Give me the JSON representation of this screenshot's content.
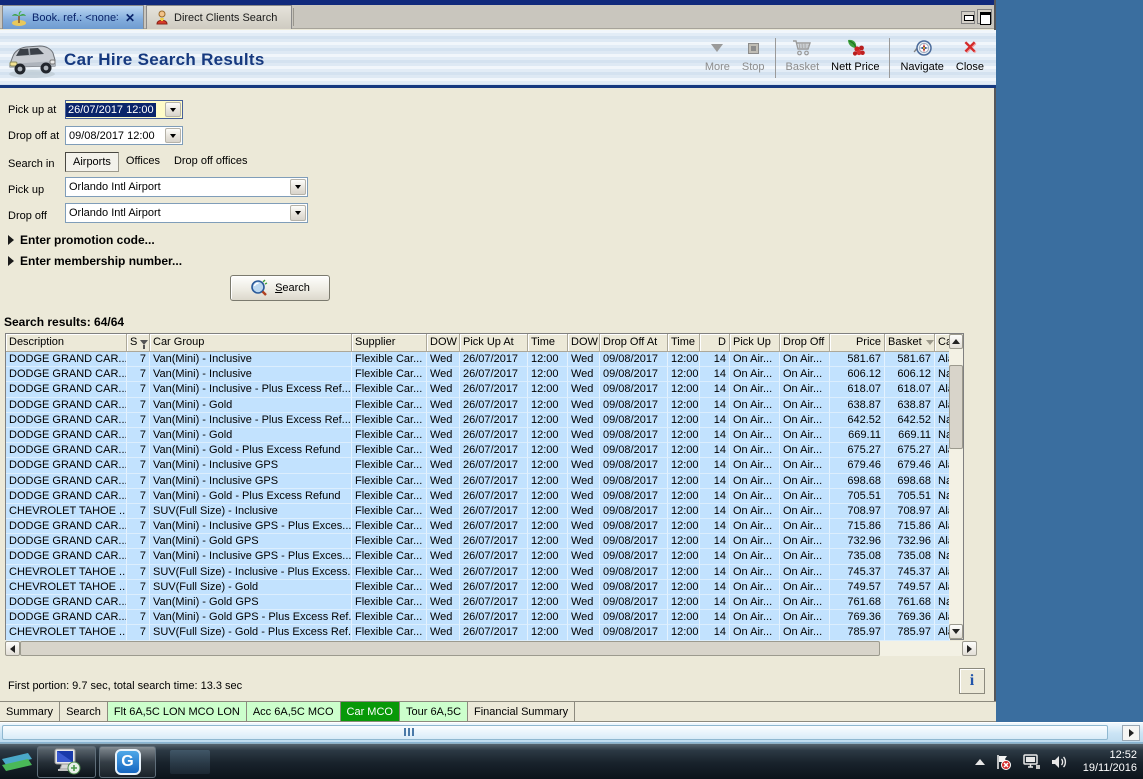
{
  "window": {
    "tabs": [
      {
        "label": "Book. ref.: <none>",
        "close": "✕"
      },
      {
        "label": "Direct Clients Search"
      }
    ],
    "title": "Car Hire Search Results",
    "toolbar": [
      {
        "label": "More"
      },
      {
        "label": "Stop"
      },
      {
        "label": "Basket"
      },
      {
        "label": "Nett Price"
      },
      {
        "label": "Navigate"
      },
      {
        "label": "Close"
      }
    ]
  },
  "form": {
    "pickup_at_label": "Pick up at",
    "pickup_at_value": "26/07/2017 12:00",
    "dropoff_at_label": "Drop off at",
    "dropoff_at_value": "09/08/2017 12:00",
    "search_in_label": "Search in",
    "search_in_options": [
      "Airports",
      "Offices",
      "Drop off offices"
    ],
    "search_in_selected": "Airports",
    "pickup_label": "Pick up",
    "pickup_value": "Orlando Intl Airport",
    "dropoff_label": "Drop off",
    "dropoff_value": "Orlando Intl Airport",
    "promo_expander": "Enter promotion code...",
    "membership_expander": "Enter membership number...",
    "search_button_pre": "S",
    "search_button_rest": "earch"
  },
  "results": {
    "summary": "Search results: 64/64",
    "status": "First portion: 9.7 sec, total search time: 13.3 sec",
    "info_button": "i",
    "columns": [
      "Description",
      "S",
      "Car Group",
      "Supplier",
      "DOW",
      "Pick Up At",
      "Time",
      "DOW",
      "Drop Off At",
      "Time",
      "D",
      "Pick Up",
      "Drop Off",
      "Price",
      "Basket",
      "Ca"
    ],
    "rows": [
      [
        "DODGE GRAND CAR...",
        "7",
        "Van(Mini) - Inclusive",
        "Flexible Car...",
        "Wed",
        "26/07/2017",
        "12:00",
        "Wed",
        "09/08/2017",
        "12:00",
        "14",
        "On Air...",
        "On Air...",
        "581.67",
        "581.67",
        "Ala"
      ],
      [
        "DODGE GRAND CAR...",
        "7",
        "Van(Mini) - Inclusive",
        "Flexible Car...",
        "Wed",
        "26/07/2017",
        "12:00",
        "Wed",
        "09/08/2017",
        "12:00",
        "14",
        "On Air...",
        "On Air...",
        "606.12",
        "606.12",
        "Na"
      ],
      [
        "DODGE GRAND CAR...",
        "7",
        "Van(Mini) - Inclusive - Plus Excess Ref...",
        "Flexible Car...",
        "Wed",
        "26/07/2017",
        "12:00",
        "Wed",
        "09/08/2017",
        "12:00",
        "14",
        "On Air...",
        "On Air...",
        "618.07",
        "618.07",
        "Ala"
      ],
      [
        "DODGE GRAND CAR...",
        "7",
        "Van(Mini) - Gold",
        "Flexible Car...",
        "Wed",
        "26/07/2017",
        "12:00",
        "Wed",
        "09/08/2017",
        "12:00",
        "14",
        "On Air...",
        "On Air...",
        "638.87",
        "638.87",
        "Ala"
      ],
      [
        "DODGE GRAND CAR...",
        "7",
        "Van(Mini) - Inclusive - Plus Excess Ref...",
        "Flexible Car...",
        "Wed",
        "26/07/2017",
        "12:00",
        "Wed",
        "09/08/2017",
        "12:00",
        "14",
        "On Air...",
        "On Air...",
        "642.52",
        "642.52",
        "Na"
      ],
      [
        "DODGE GRAND CAR...",
        "7",
        "Van(Mini) - Gold",
        "Flexible Car...",
        "Wed",
        "26/07/2017",
        "12:00",
        "Wed",
        "09/08/2017",
        "12:00",
        "14",
        "On Air...",
        "On Air...",
        "669.11",
        "669.11",
        "Na"
      ],
      [
        "DODGE GRAND CAR...",
        "7",
        "Van(Mini) - Gold - Plus Excess Refund",
        "Flexible Car...",
        "Wed",
        "26/07/2017",
        "12:00",
        "Wed",
        "09/08/2017",
        "12:00",
        "14",
        "On Air...",
        "On Air...",
        "675.27",
        "675.27",
        "Ala"
      ],
      [
        "DODGE GRAND CAR...",
        "7",
        "Van(Mini) - Inclusive GPS",
        "Flexible Car...",
        "Wed",
        "26/07/2017",
        "12:00",
        "Wed",
        "09/08/2017",
        "12:00",
        "14",
        "On Air...",
        "On Air...",
        "679.46",
        "679.46",
        "Ala"
      ],
      [
        "DODGE GRAND CAR...",
        "7",
        "Van(Mini) - Inclusive GPS",
        "Flexible Car...",
        "Wed",
        "26/07/2017",
        "12:00",
        "Wed",
        "09/08/2017",
        "12:00",
        "14",
        "On Air...",
        "On Air...",
        "698.68",
        "698.68",
        "Na"
      ],
      [
        "DODGE GRAND CAR...",
        "7",
        "Van(Mini) - Gold - Plus Excess Refund",
        "Flexible Car...",
        "Wed",
        "26/07/2017",
        "12:00",
        "Wed",
        "09/08/2017",
        "12:00",
        "14",
        "On Air...",
        "On Air...",
        "705.51",
        "705.51",
        "Na"
      ],
      [
        "CHEVROLET TAHOE ...",
        "7",
        "SUV(Full Size) - Inclusive",
        "Flexible Car...",
        "Wed",
        "26/07/2017",
        "12:00",
        "Wed",
        "09/08/2017",
        "12:00",
        "14",
        "On Air...",
        "On Air...",
        "708.97",
        "708.97",
        "Ala"
      ],
      [
        "DODGE GRAND CAR...",
        "7",
        "Van(Mini) - Inclusive GPS - Plus Exces...",
        "Flexible Car...",
        "Wed",
        "26/07/2017",
        "12:00",
        "Wed",
        "09/08/2017",
        "12:00",
        "14",
        "On Air...",
        "On Air...",
        "715.86",
        "715.86",
        "Ala"
      ],
      [
        "DODGE GRAND CAR...",
        "7",
        "Van(Mini) - Gold GPS",
        "Flexible Car...",
        "Wed",
        "26/07/2017",
        "12:00",
        "Wed",
        "09/08/2017",
        "12:00",
        "14",
        "On Air...",
        "On Air...",
        "732.96",
        "732.96",
        "Ala"
      ],
      [
        "DODGE GRAND CAR...",
        "7",
        "Van(Mini) - Inclusive GPS - Plus Exces...",
        "Flexible Car...",
        "Wed",
        "26/07/2017",
        "12:00",
        "Wed",
        "09/08/2017",
        "12:00",
        "14",
        "On Air...",
        "On Air...",
        "735.08",
        "735.08",
        "Na"
      ],
      [
        "CHEVROLET TAHOE ...",
        "7",
        "SUV(Full Size) - Inclusive - Plus Excess...",
        "Flexible Car...",
        "Wed",
        "26/07/2017",
        "12:00",
        "Wed",
        "09/08/2017",
        "12:00",
        "14",
        "On Air...",
        "On Air...",
        "745.37",
        "745.37",
        "Ala"
      ],
      [
        "CHEVROLET TAHOE ...",
        "7",
        "SUV(Full Size) - Gold",
        "Flexible Car...",
        "Wed",
        "26/07/2017",
        "12:00",
        "Wed",
        "09/08/2017",
        "12:00",
        "14",
        "On Air...",
        "On Air...",
        "749.57",
        "749.57",
        "Ala"
      ],
      [
        "DODGE GRAND CAR...",
        "7",
        "Van(Mini) - Gold GPS",
        "Flexible Car...",
        "Wed",
        "26/07/2017",
        "12:00",
        "Wed",
        "09/08/2017",
        "12:00",
        "14",
        "On Air...",
        "On Air...",
        "761.68",
        "761.68",
        "Na"
      ],
      [
        "DODGE GRAND CAR...",
        "7",
        "Van(Mini) - Gold GPS - Plus Excess Ref...",
        "Flexible Car...",
        "Wed",
        "26/07/2017",
        "12:00",
        "Wed",
        "09/08/2017",
        "12:00",
        "14",
        "On Air...",
        "On Air...",
        "769.36",
        "769.36",
        "Ala"
      ],
      [
        "CHEVROLET TAHOE ...",
        "7",
        "SUV(Full Size) - Gold - Plus Excess Ref...",
        "Flexible Car...",
        "Wed",
        "26/07/2017",
        "12:00",
        "Wed",
        "09/08/2017",
        "12:00",
        "14",
        "On Air...",
        "On Air...",
        "785.97",
        "785.97",
        "Ala"
      ]
    ]
  },
  "bottom_tabs": [
    {
      "label": "Summary",
      "style": "plain"
    },
    {
      "label": "Search",
      "style": "plain"
    },
    {
      "label": "Flt 6A,5C LON MCO LON",
      "style": "green"
    },
    {
      "label": "Acc 6A,5C MCO",
      "style": "green"
    },
    {
      "label": "Car MCO",
      "style": "green-selected"
    },
    {
      "label": "Tour 6A,5C",
      "style": "green"
    },
    {
      "label": "Financial Summary",
      "style": "plain"
    }
  ],
  "taskbar": {
    "clock_time": "12:52",
    "clock_date": "19/11/2016"
  }
}
